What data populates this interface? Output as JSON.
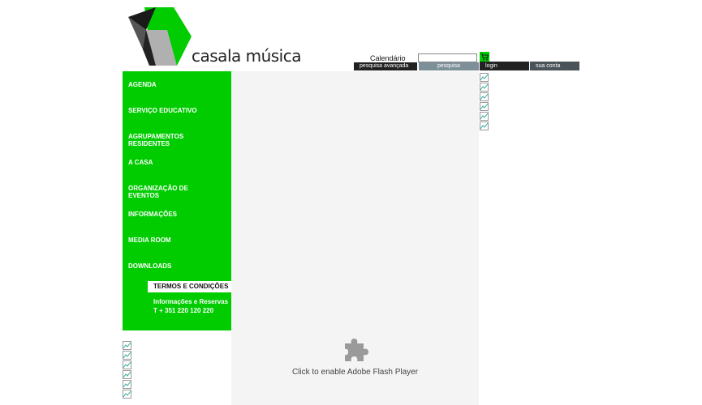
{
  "logo": {
    "brand_text": "casa",
    "brand_la": "la",
    "brand_musica": " música",
    "colors": {
      "green": "#00cc00",
      "dark": "#1a1a1a",
      "grey": "#b0b0b0"
    }
  },
  "toolbar": {
    "calendar_label": "Calendário",
    "search_value": "",
    "advanced_search_label": "pesquisa avançada",
    "search_button_label": "pesquisa",
    "login_label": "login",
    "account_label": "sua conta",
    "cart_icon": "shopping-cart-icon"
  },
  "sidebar": {
    "background": "#00cc00",
    "items": [
      {
        "label": "AGENDA"
      },
      {
        "label": "SERVIÇO EDUCATIVO"
      },
      {
        "label": "AGRUPAMENTOS RESIDENTES"
      },
      {
        "label": "A CASA"
      },
      {
        "label": "ORGANIZAÇÃO DE EVENTOS"
      },
      {
        "label": "INFORMAÇÕES"
      },
      {
        "label": "MEDIA ROOM"
      },
      {
        "label": "DOWNLOADS"
      }
    ],
    "terms_label": "TERMOS E CONDIÇÕES",
    "info_line1": "Informações e Reservas",
    "info_line2": "T + 351 220 120 220"
  },
  "main": {
    "plugin_icon": "puzzle-piece-icon",
    "flash_message": "Click to enable Adobe Flash Player"
  }
}
